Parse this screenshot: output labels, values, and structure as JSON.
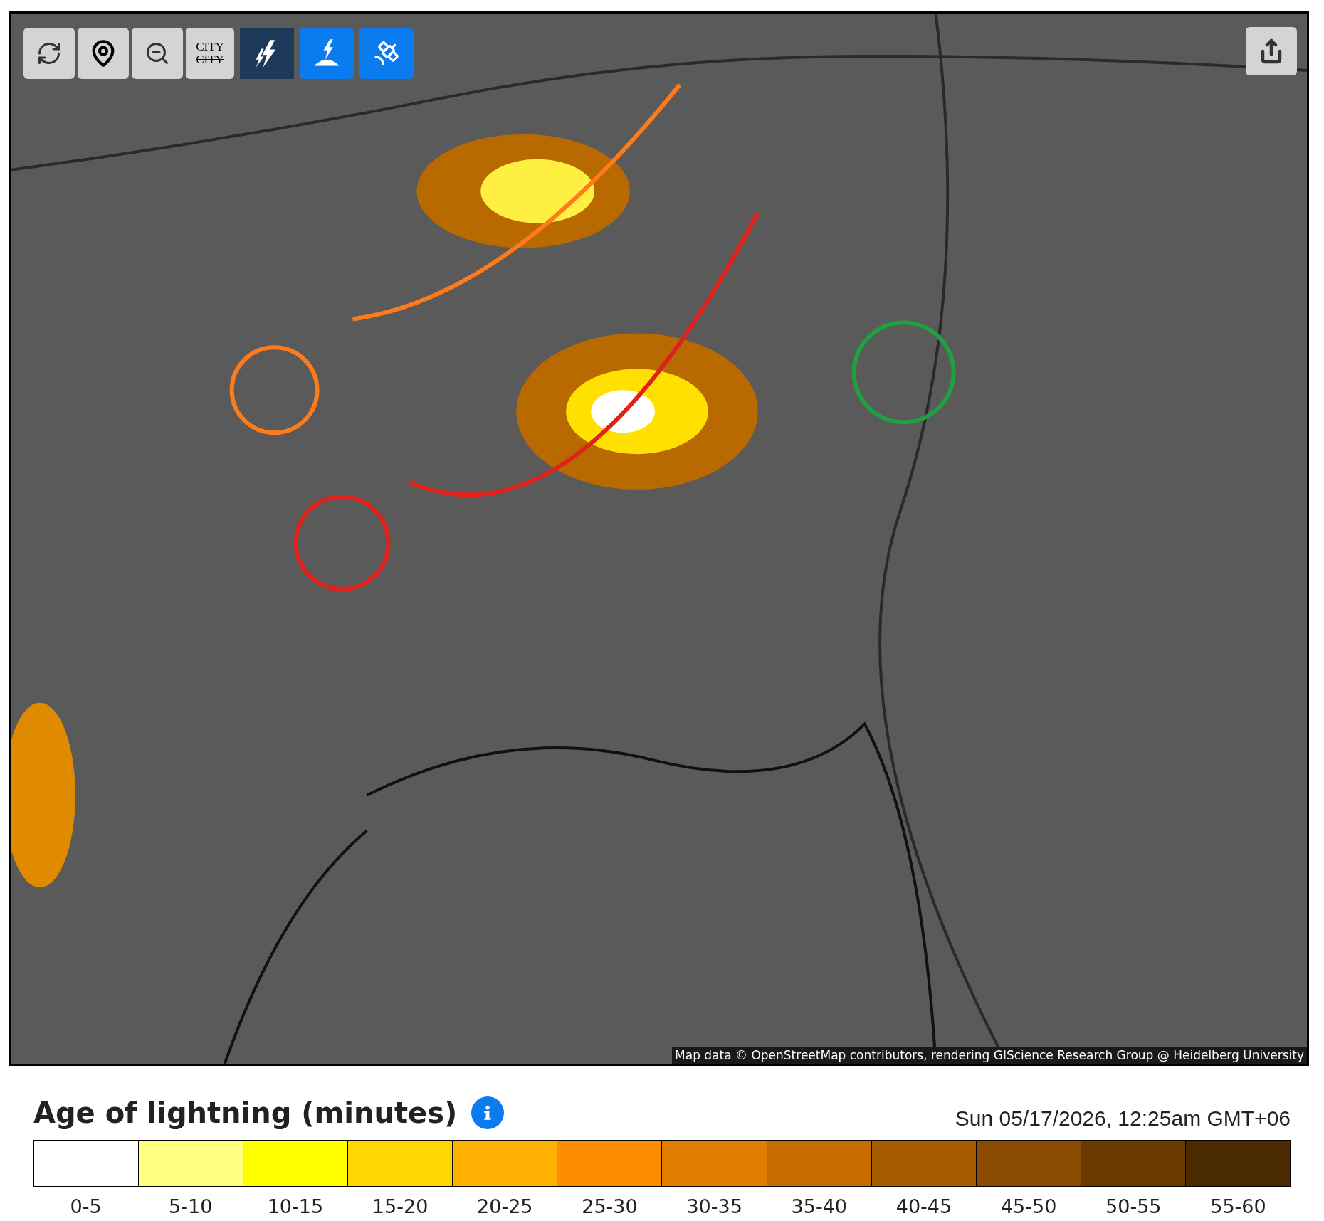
{
  "map": {
    "tools": [
      {
        "kind": "refresh"
      },
      {
        "kind": "locate"
      },
      {
        "kind": "zoom-out"
      },
      {
        "kind": "city",
        "label_top": "CITY",
        "label_bottom": "CITY"
      }
    ],
    "layers": [
      {
        "kind": "strokes",
        "on": false
      },
      {
        "kind": "ground",
        "on": true
      },
      {
        "kind": "satellite",
        "on": true
      }
    ],
    "attribution": "Map data © OpenStreetMap contributors, rendering GIScience Research Group @ Heidelberg University"
  },
  "legend": {
    "title": "Age of lightning (minutes)",
    "timestamp": "Sun 05/17/2026, 12:25am GMT+06",
    "bins": [
      {
        "label": "0-5",
        "color": "#ffffff"
      },
      {
        "label": "5-10",
        "color": "#ffff80"
      },
      {
        "label": "10-15",
        "color": "#ffff00"
      },
      {
        "label": "15-20",
        "color": "#ffd700"
      },
      {
        "label": "20-25",
        "color": "#ffb000"
      },
      {
        "label": "25-30",
        "color": "#ff8c00"
      },
      {
        "label": "30-35",
        "color": "#e07c00"
      },
      {
        "label": "35-40",
        "color": "#c86c00"
      },
      {
        "label": "40-45",
        "color": "#a85c00"
      },
      {
        "label": "45-50",
        "color": "#8a4a00"
      },
      {
        "label": "50-55",
        "color": "#6a3a00"
      },
      {
        "label": "55-60",
        "color": "#4a2c00"
      }
    ]
  }
}
